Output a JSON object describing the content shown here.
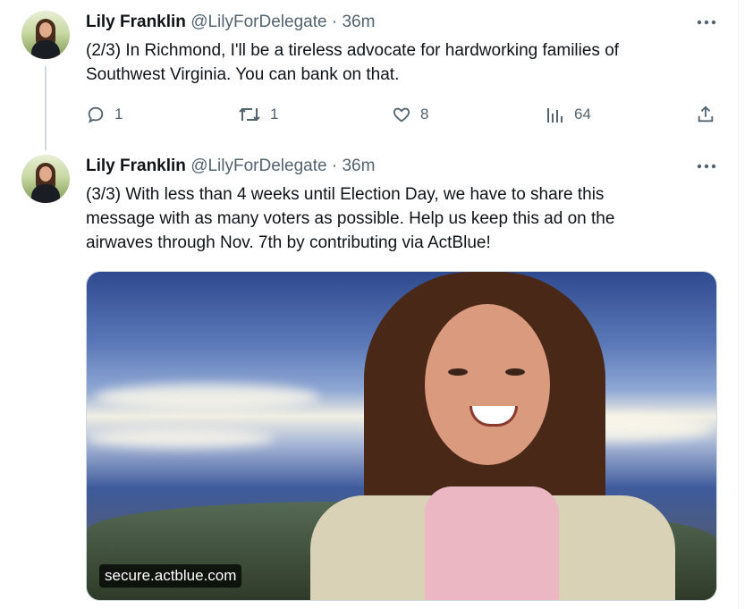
{
  "tweets": [
    {
      "name": "Lily Franklin",
      "handle": "@LilyForDelegate",
      "separator": "·",
      "time": "36m",
      "text_lines": [
        "(2/3) In Richmond, I'll be a tireless advocate for hardworking families of",
        "Southwest Virginia. You can bank on that."
      ],
      "actions": {
        "replies": "1",
        "retweets": "1",
        "likes": "8",
        "views": "64"
      }
    },
    {
      "name": "Lily Franklin",
      "handle": "@LilyForDelegate",
      "separator": "·",
      "time": "36m",
      "text_lines": [
        "(3/3) With less than 4 weeks until Election Day, we have to share this",
        "message with as many voters as possible. Help us keep this ad on the",
        "airwaves through Nov. 7th by contributing via ActBlue!"
      ],
      "media": {
        "domain_label": "secure.actblue.com"
      }
    }
  ],
  "icons": {
    "more": "more-horizontal-icon",
    "reply": "reply-icon",
    "retweet": "retweet-icon",
    "like": "heart-icon",
    "views": "analytics-icon",
    "share": "share-icon"
  },
  "colors": {
    "text": "#0f1419",
    "muted": "#536471",
    "thread_line": "#cfd9de"
  }
}
